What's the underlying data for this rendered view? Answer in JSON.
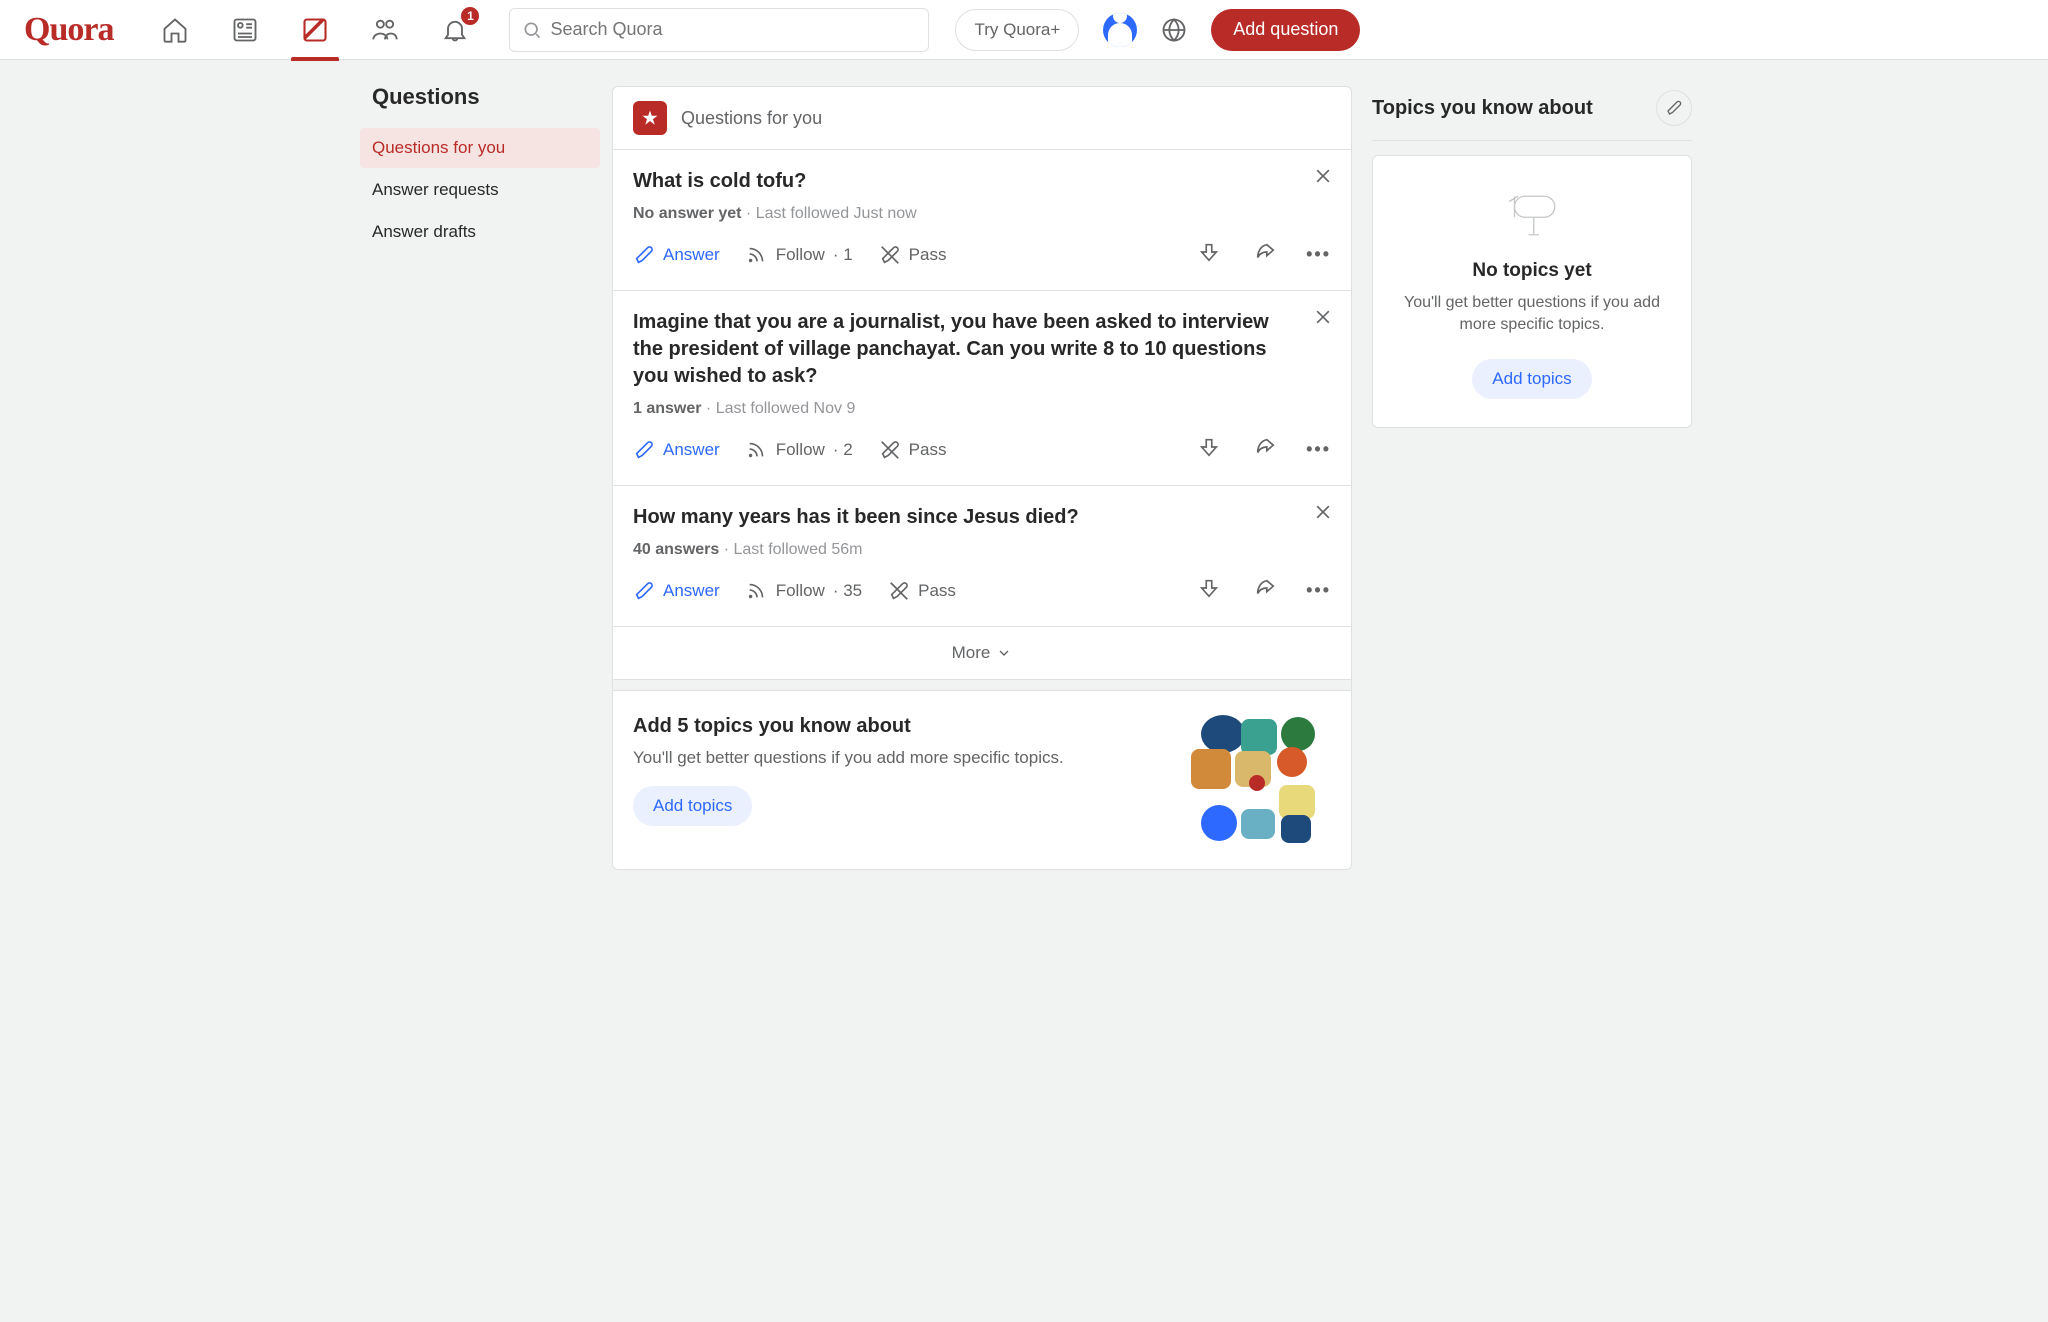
{
  "brand": "Quora",
  "header": {
    "search_placeholder": "Search Quora",
    "try_plus": "Try Quora+",
    "add_question": "Add question",
    "notif_badge": "1"
  },
  "sidebar": {
    "title": "Questions",
    "items": [
      {
        "label": "Questions for you",
        "selected": true
      },
      {
        "label": "Answer requests",
        "selected": false
      },
      {
        "label": "Answer drafts",
        "selected": false
      }
    ]
  },
  "feed": {
    "heading": "Questions for you",
    "more": "More",
    "cards": [
      {
        "title": "What is cold tofu?",
        "answers": "No answer yet",
        "followed": "Last followed Just now",
        "follow_count": "1"
      },
      {
        "title": "Imagine that you are a journalist, you have been asked to interview the president of village panchayat. Can you write 8 to 10 questions you wished to ask?",
        "answers": "1 answer",
        "followed": "Last followed Nov 9",
        "follow_count": "2"
      },
      {
        "title": "How many years has it been since Jesus died?",
        "answers": "40 answers",
        "followed": "Last followed 56m",
        "follow_count": "35"
      }
    ],
    "action_labels": {
      "answer": "Answer",
      "follow": "Follow",
      "pass": "Pass"
    }
  },
  "topic_promo": {
    "title": "Add 5 topics you know about",
    "body": "You'll get better questions if you add more specific topics.",
    "button": "Add topics"
  },
  "rightcol": {
    "heading": "Topics you know about",
    "empty_title": "No topics yet",
    "empty_body": "You'll get better questions if you add more specific topics.",
    "button": "Add topics"
  }
}
